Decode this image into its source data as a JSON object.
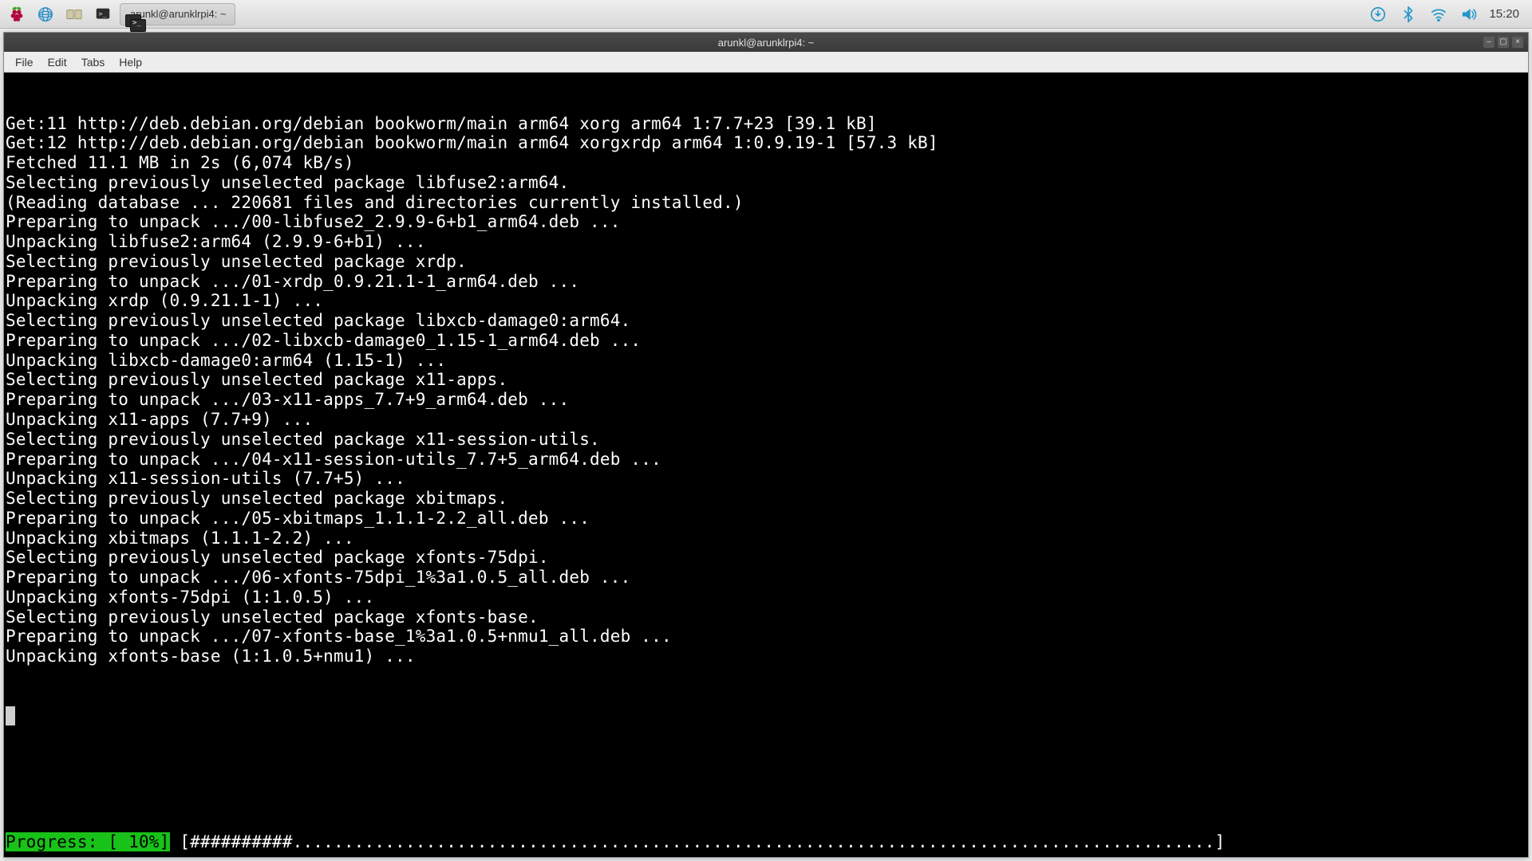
{
  "taskbar": {
    "task_title": "arunkl@arunklrpi4: ~",
    "clock": "15:20"
  },
  "window": {
    "title": "arunkl@arunklrpi4: ~",
    "menus": [
      "File",
      "Edit",
      "Tabs",
      "Help"
    ],
    "controls": {
      "min": "–",
      "max": "▢",
      "close": "×"
    }
  },
  "terminal": {
    "lines": [
      "Get:11 http://deb.debian.org/debian bookworm/main arm64 xorg arm64 1:7.7+23 [39.1 kB]",
      "Get:12 http://deb.debian.org/debian bookworm/main arm64 xorgxrdp arm64 1:0.9.19-1 [57.3 kB]",
      "Fetched 11.1 MB in 2s (6,074 kB/s)",
      "Selecting previously unselected package libfuse2:arm64.",
      "(Reading database ... 220681 files and directories currently installed.)",
      "Preparing to unpack .../00-libfuse2_2.9.9-6+b1_arm64.deb ...",
      "Unpacking libfuse2:arm64 (2.9.9-6+b1) ...",
      "Selecting previously unselected package xrdp.",
      "Preparing to unpack .../01-xrdp_0.9.21.1-1_arm64.deb ...",
      "Unpacking xrdp (0.9.21.1-1) ...",
      "Selecting previously unselected package libxcb-damage0:arm64.",
      "Preparing to unpack .../02-libxcb-damage0_1.15-1_arm64.deb ...",
      "Unpacking libxcb-damage0:arm64 (1.15-1) ...",
      "Selecting previously unselected package x11-apps.",
      "Preparing to unpack .../03-x11-apps_7.7+9_arm64.deb ...",
      "Unpacking x11-apps (7.7+9) ...",
      "Selecting previously unselected package x11-session-utils.",
      "Preparing to unpack .../04-x11-session-utils_7.7+5_arm64.deb ...",
      "Unpacking x11-session-utils (7.7+5) ...",
      "Selecting previously unselected package xbitmaps.",
      "Preparing to unpack .../05-xbitmaps_1.1.1-2.2_all.deb ...",
      "Unpacking xbitmaps (1.1.1-2.2) ...",
      "Selecting previously unselected package xfonts-75dpi.",
      "Preparing to unpack .../06-xfonts-75dpi_1%3a1.0.5_all.deb ...",
      "Unpacking xfonts-75dpi (1:1.0.5) ...",
      "Selecting previously unselected package xfonts-base.",
      "Preparing to unpack .../07-xfonts-base_1%3a1.0.5+nmu1_all.deb ...",
      "Unpacking xfonts-base (1:1.0.5+nmu1) ..."
    ],
    "progress": {
      "label": "Progress: [ 10%]",
      "bar": " [##########..........................................................................................] "
    }
  }
}
